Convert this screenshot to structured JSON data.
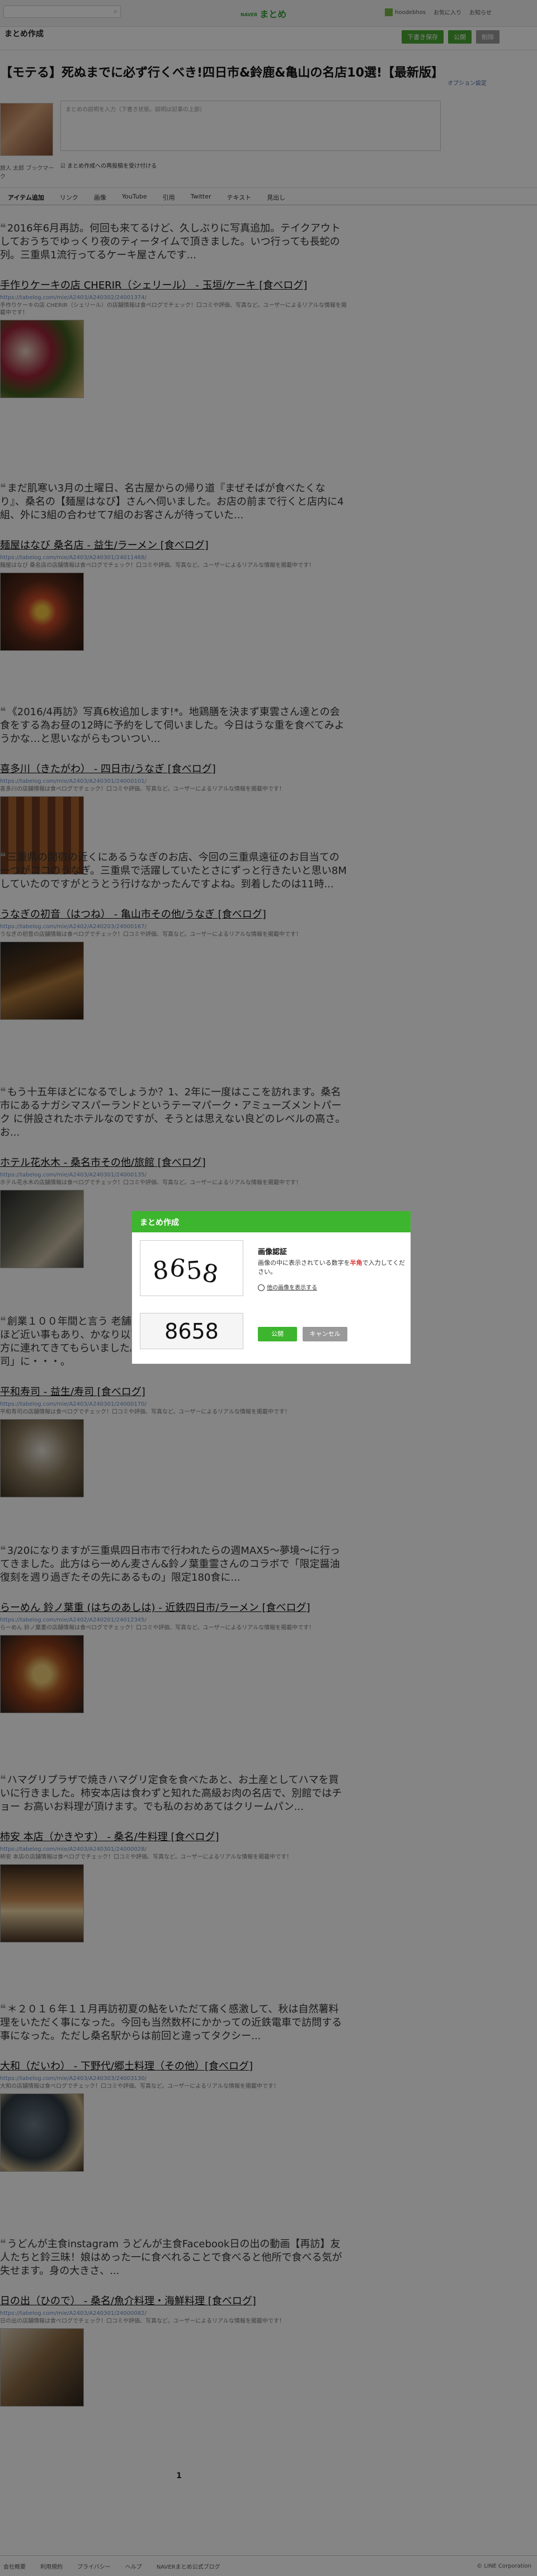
{
  "topbar": {
    "search_placeholder": "",
    "brand_small": "NAVER",
    "brand": "まとめ",
    "user_name": "hoodebhos",
    "favorites": "お気に入り",
    "notices": "お知らせ"
  },
  "site": {
    "name": "まとめ作成",
    "btn_draft": "下書き保存",
    "btn_publish": "公開",
    "btn_delete": "削除"
  },
  "title": "【モテる】死ぬまでに必ず行くべき!四日市&鈴鹿&亀山の名店10選!【最新版】",
  "options_link": "オプション設定",
  "author": {
    "desc_placeholder": "まとめの説明を入力（下書き状態。説明は記事の上部）",
    "name": "旅人 太郎 ブックマーク",
    "repost_label": "まとめ作成への再投稿を受け付ける"
  },
  "tabs": [
    "アイテム追加",
    "リンク",
    "画像",
    "YouTube",
    "引用",
    "Twitter",
    "テキスト",
    "見出し"
  ],
  "items": [
    {
      "quote": "2016年6月再訪。何回も来てるけど、久しぶりに写真追加。テイクアウトしておうちでゆっくり夜のティータイムで頂きました。いつ行っても長蛇の列。三重県1流行ってるケーキ屋さんです...",
      "link": "手作りケーキの店 CHERIR（シェリール） - 玉垣/ケーキ [食べログ]",
      "url": "https://tabelog.com/mie/A2403/A240302/24001374/",
      "desc": "手作りケーキの店 CHERIR（シェリール）の店舗情報は食べログでチェック！口コミや評価、写真など。ユーザーによるリアルな情報を掲載中です！"
    },
    {
      "quote": "まだ肌寒い3月の土曜日、名古屋からの帰り道『まぜそばが食べたくなり』、桑名の【麺屋はなび】さんへ伺いました。お店の前まで行くと店内に4組、外に3組の合わせて7組のお客さんが待っていた...",
      "link": "麺屋はなび 桑名店 - 益生/ラーメン [食べログ]",
      "url": "https://tabelog.com/mie/A2403/A240301/24011468/",
      "desc": "麺屋はなび 桑名店の店舗情報は食べログでチェック！口コミや評価、写真など。ユーザーによるリアルな情報を掲載中です！"
    },
    {
      "quote": "《2016/4再訪》写真6枚追加します!*。地鶏膳を決まず東雲さん達との会食をする為お昼の12時に予約をして伺いました。今日はうな重を食べてみようかな…と思いながらもついつい...",
      "link": "喜多川（きたがわ） - 四日市/うなぎ [食べログ]",
      "url": "https://tabelog.com/mie/A2403/A240301/24000101/",
      "desc": "喜多川の店舗情報は食べログでチェック！口コミや評価、写真など。ユーザーによるリアルな情報を掲載中です！"
    },
    {
      "quote": "三重県の閉宿の近くにあるうなぎのお店、今回の三重県遠征のお目当ての一つがココのうなぎ。三重県で活躍していたとさにずっと行きたいと思い8Mしていたのですがとうとう行けなかったんですよね。到着したのは11時...",
      "link": "うなぎの初音（はつね） - 亀山市その他/うなぎ [食べログ]",
      "url": "https://tabelog.com/mie/A2402/A240203/24000167/",
      "desc": "うなぎの初音の店舗情報は食べログでチェック！口コミや評価、写真など。ユーザーによるリアルな情報を掲載中です！"
    },
    {
      "quote": "もう十五年ほどになるでしょうか？1、2年に一度はここを訪れます。桑名市にあるナガシマスパーランドというテーマパーク・アミューズメントパーク に併設されたホテルなのですが、そうとは思えない良どのレベルの高さ。お...",
      "link": "ホテル花水木 - 桑名市その他/旅館 [食べログ]",
      "url": "https://tabelog.com/mie/A2403/A240301/24000135/",
      "desc": "ホテル花水木の店舗情報は食べログでチェック！口コミや評価、写真など。ユーザーによるリアルな情報を掲載中です！"
    },
    {
      "quote": "創業１００年間と言う 老舗中の老舗・・・。ニッポンの真ん中にある駅にほど近い事もあり、かなり以前から気になっていたお店です。今日のお供の方に連れてきてもらいました。お値段は明治時代から創業している「平和寿司」に・・・。",
      "link": "平和寿司 - 益生/寿司 [食べログ]",
      "url": "https://tabelog.com/mie/A2403/A240301/24000170/",
      "desc": "平和寿司の店舗情報は食べログでチェック！口コミや評価、写真など。ユーザーによるリアルな情報を掲載中です！"
    },
    {
      "quote": "3/20になりますが三重県四日市市で行われたらの週MAX5〜夢境〜に行ってきました。此方はら一めん麦さん&鈴ノ葉重霊さんのコラボで「限定醤油復刻を週り過ぎたその先にあるもの」限定180食に...",
      "link": "らーめん 鈴ノ葉重 (はちのあしは) - 近鉄四日市/ラーメン [食べログ]",
      "url": "https://tabelog.com/mie/A2402/A240201/24012345/",
      "desc": "らーめん 鈴ノ葉重の店舗情報は食べログでチェック！口コミや評価、写真など。ユーザーによるリアルな情報を掲載中です！"
    },
    {
      "quote": "ハマグリプラザで焼きハマグリ定食を食べたあと、お土産としてハマを買いに行きました。柿安本店は食わずと知れた高級お肉の名店で、別館ではチョー お高いお料理が頂けます。でも私のおめあてはクリームパン...",
      "link": "柿安 本店（かきやす） - 桑名/牛料理 [食べログ]",
      "url": "https://tabelog.com/mie/A2403/A240301/24000028/",
      "desc": "柿安 本店の店舗情報は食べログでチェック！口コミや評価、写真など。ユーザーによるリアルな情報を掲載中です！"
    },
    {
      "quote": "＊２０１６年１１月再訪初夏の鮎をいただて痛く感激して、秋は自然薯料理をいただく事になった。今回も当然数杯にかかっての近鉄電車で訪問する事になった。ただし桑名駅からは前回と違ってタクシー...",
      "link": "大和（だいわ） - 下野代/郷土料理（その他）[食べログ]",
      "url": "https://tabelog.com/mie/A2403/A240303/24003130/",
      "desc": "大和の店舗情報は食べログでチェック！口コミや評価、写真など。ユーザーによるリアルな情報を掲載中です！"
    },
    {
      "quote": "うどんが主食instagram うどんが主食Facebook日の出の動画【再訪】友人たちと鈴三昧！娘はめった一に食べれることで食べると他所で食べる気が失せます。身の大きさ、...",
      "link": "日の出（ひので） - 桑名/魚介料理・海鮮料理 [食べログ]",
      "url": "https://tabelog.com/mie/A2403/A240301/24000082/",
      "desc": "日の出の店舗情報は食べログでチェック！口コミや評価、写真など。ユーザーによるリアルな情報を掲載中です！"
    }
  ],
  "pager": "1",
  "footer": {
    "links": [
      "会社概要",
      "利用規約",
      "プライバシー",
      "ヘルプ",
      "NAVERまとめ公式ブログ"
    ],
    "copyright": "© LINE Corporation"
  },
  "modal": {
    "header": "まとめ作成",
    "captcha_digits": [
      "8",
      "6",
      "5",
      "8"
    ],
    "title": "画像認証",
    "desc_pre": "画像の中に表示されている数字を",
    "desc_highlight": "半角",
    "desc_post": "で入力してください。",
    "reload": "他の画像を表示する",
    "input_value": "8658",
    "ok": "公開",
    "cancel": "キャンセル"
  },
  "colors": {
    "accent": "#3db52e",
    "link": "#6a8fc7",
    "error": "#d33333"
  }
}
